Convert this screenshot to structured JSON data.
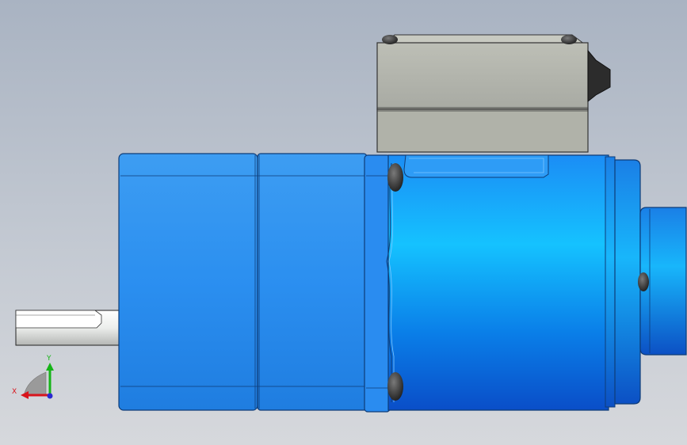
{
  "triad": {
    "x_label": "X",
    "y_label": "Y",
    "x_color": "#d8141c",
    "y_color": "#16b418",
    "z_color": "#2a2ad0"
  },
  "colors": {
    "motor_blue": "#1a9fff",
    "gearbox_blue": "#2a90f0",
    "terminal_box_grey": "#b8bab1",
    "shaft_grey": "#e4e6e4"
  }
}
